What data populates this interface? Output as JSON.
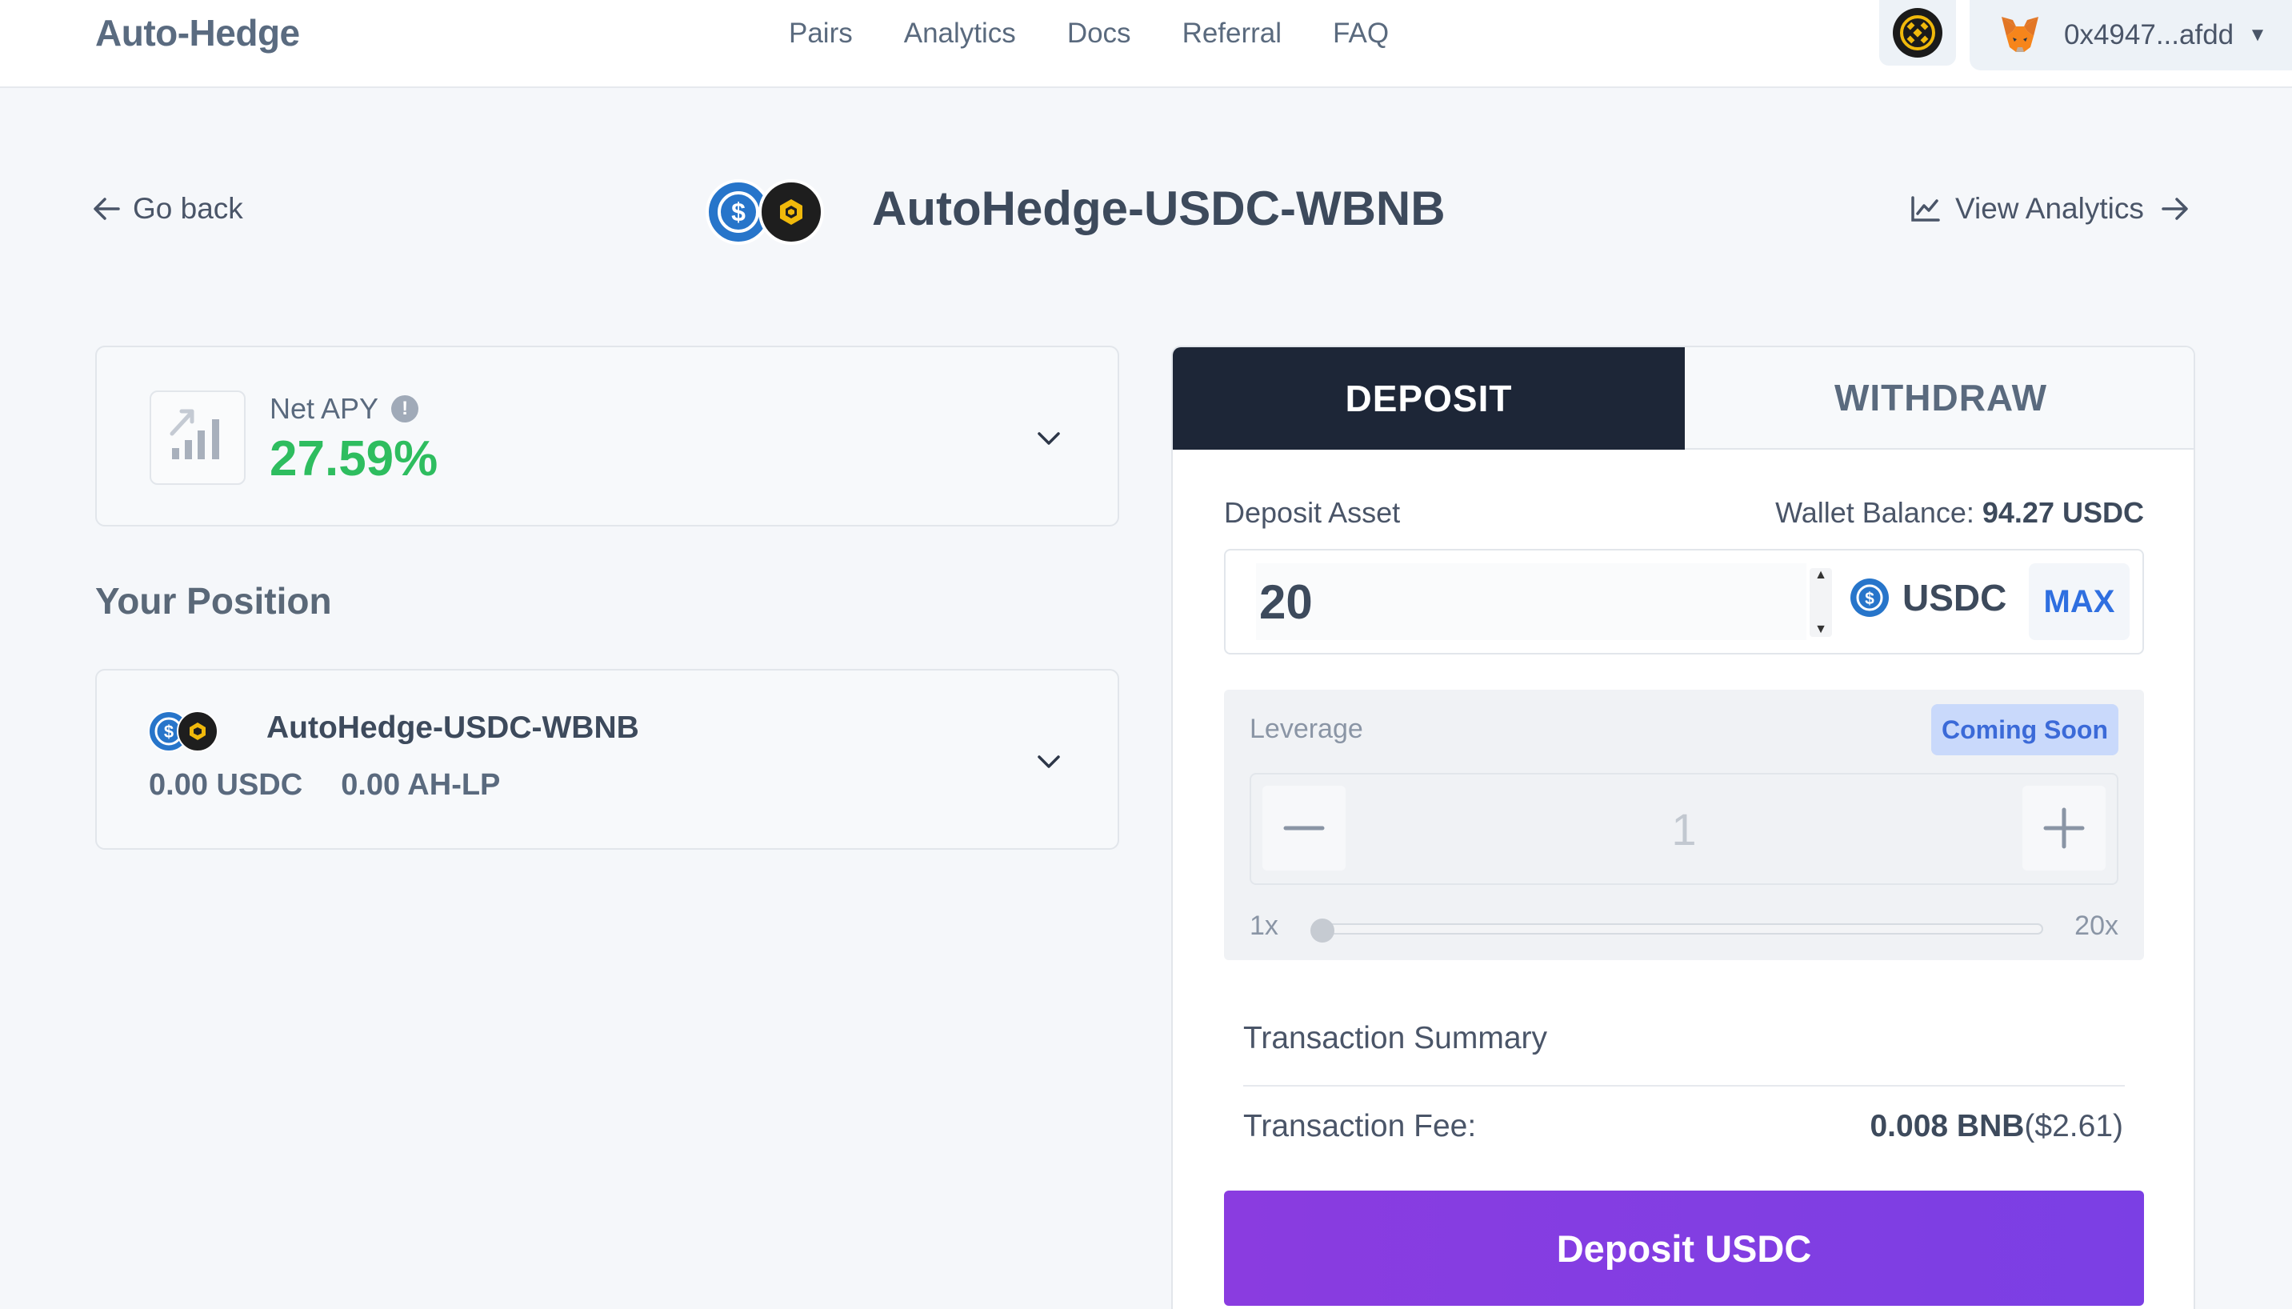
{
  "header": {
    "logo": "Auto-Hedge",
    "nav": [
      "Pairs",
      "Analytics",
      "Docs",
      "Referral",
      "FAQ"
    ],
    "network_icon": "bnb-chain-icon",
    "wallet_icon": "metamask-fox-icon",
    "wallet_address": "0x4947...afdd"
  },
  "title_row": {
    "go_back": "Go back",
    "pair_name": "AutoHedge-USDC-WBNB",
    "view_analytics": "View Analytics"
  },
  "apy_card": {
    "label": "Net APY",
    "info_icon": "!",
    "value": "27.59%",
    "value_color": "#2ebd5f"
  },
  "position": {
    "section_title": "Your Position",
    "pair_name": "AutoHedge-USDC-WBNB",
    "usdc_amount": "0.00 USDC",
    "lp_amount": "0.00 AH-LP"
  },
  "panel": {
    "tabs": [
      "DEPOSIT",
      "WITHDRAW"
    ],
    "active_tab": "DEPOSIT",
    "deposit_asset_label": "Deposit Asset",
    "wallet_balance_label": "Wallet Balance:",
    "wallet_balance_value": "94.27 USDC",
    "amount": "20",
    "asset_symbol": "USDC",
    "max_label": "MAX",
    "leverage_label": "Leverage",
    "coming_soon": "Coming Soon",
    "leverage_value": "1",
    "slider_min": "1x",
    "slider_max": "20x",
    "slider_level": 0,
    "summary_title": "Transaction Summary",
    "fee_label": "Transaction Fee:",
    "fee_value": "0.008 BNB",
    "fee_usd": "($2.61)",
    "deposit_button": "Deposit USDC",
    "button_color": "#8a3ce0"
  }
}
